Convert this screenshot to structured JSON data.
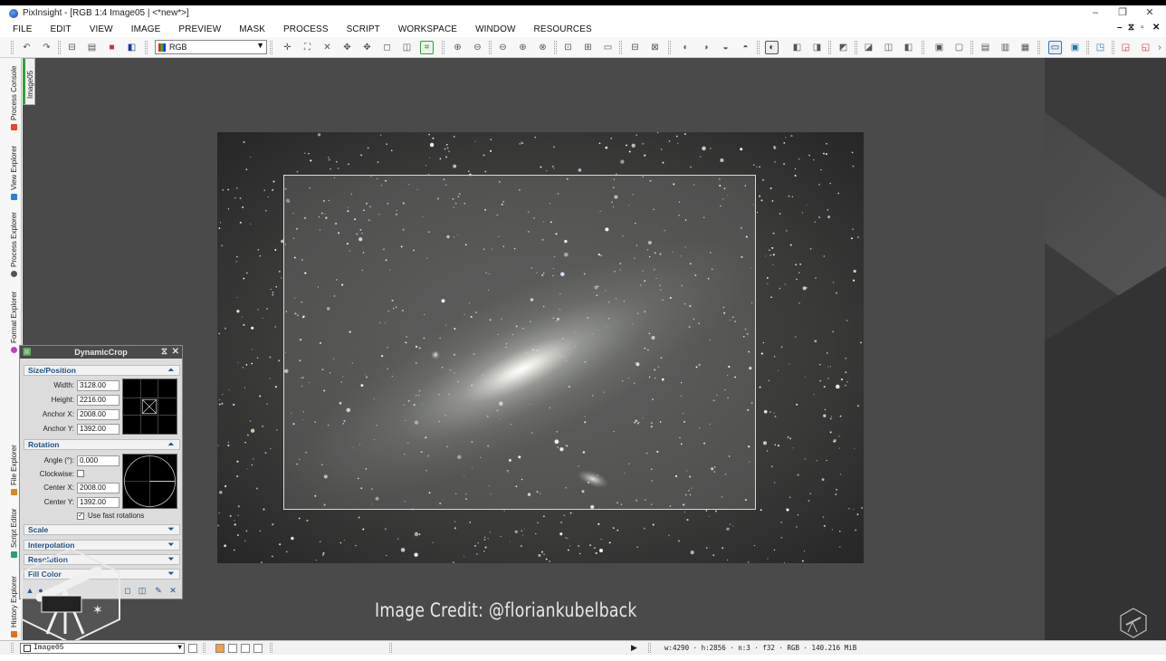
{
  "window": {
    "title": "PixInsight - [RGB 1:4 Image05 | <*new*>]",
    "controls": {
      "minimize": "–",
      "restore": "❐",
      "close": "✕"
    }
  },
  "menubar": {
    "items": [
      "FILE",
      "EDIT",
      "VIEW",
      "IMAGE",
      "PREVIEW",
      "MASK",
      "PROCESS",
      "SCRIPT",
      "WORKSPACE",
      "WINDOW",
      "RESOURCES"
    ],
    "mdi_controls": [
      "–",
      "⧖",
      "▫",
      "✕"
    ]
  },
  "toolbar": {
    "channel_select": "RGB"
  },
  "side_tabs": [
    {
      "label": "Process Console",
      "color": "#e04a2a"
    },
    {
      "label": "View Explorer",
      "color": "#2a7fd6"
    },
    {
      "label": "Process Explorer",
      "color": "#555555"
    },
    {
      "label": "Format Explorer",
      "color": "#c040c0"
    },
    {
      "label": "File Explorer",
      "color": "#d08a20"
    },
    {
      "label": "Script Editor",
      "color": "#2aa070"
    },
    {
      "label": "History Explorer",
      "color": "#e07020"
    }
  ],
  "image_tab": {
    "label": "Image05"
  },
  "credit": {
    "text": "Image Credit: @floriankubelback"
  },
  "dynamic_crop": {
    "title": "DynamicCrop",
    "size_position": {
      "header": "Size/Position",
      "width_label": "Width:",
      "width": "3128.00",
      "height_label": "Height:",
      "height": "2216.00",
      "anchor_x_label": "Anchor X:",
      "anchor_x": "2008.00",
      "anchor_y_label": "Anchor Y:",
      "anchor_y": "1392.00"
    },
    "rotation": {
      "header": "Rotation",
      "angle_label": "Angle (°):",
      "angle": "0.000",
      "clockwise_label": "Clockwise:",
      "center_x_label": "Center X:",
      "center_x": "2008.00",
      "center_y_label": "Center Y:",
      "center_y": "1392.00",
      "fast_rotations_label": "Use fast rotations"
    },
    "sections": [
      "Scale",
      "Interpolation",
      "Resolution",
      "Fill Color"
    ]
  },
  "statusbar": {
    "view": "Image05",
    "info": "w:4290 · h:2856 · n:3 · f32 · RGB · 140.216 MiB"
  }
}
